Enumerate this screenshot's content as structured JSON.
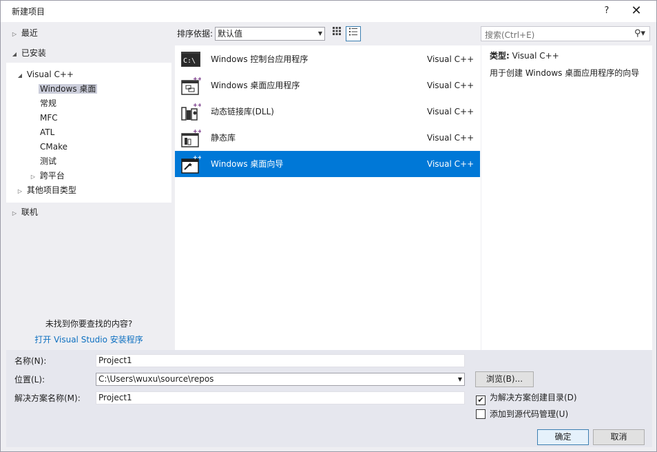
{
  "window": {
    "title": "新建项目",
    "help": "?",
    "close": "✕"
  },
  "tree": {
    "recent": "最近",
    "installed": "已安装",
    "visual_cpp": "Visual C++",
    "leaves": [
      "Windows 桌面",
      "常规",
      "MFC",
      "ATL",
      "CMake",
      "测试"
    ],
    "cross_platform": "跨平台",
    "other_types": "其他项目类型",
    "online": "联机",
    "not_found": "未找到你要查找的内容?",
    "installer_link": "打开 Visual Studio 安装程序"
  },
  "sort": {
    "label": "排序依据:",
    "value": "默认值"
  },
  "search": {
    "placeholder": "搜索(Ctrl+E)"
  },
  "templates": [
    {
      "name": "Windows 控制台应用程序",
      "lang": "Visual C++",
      "icon": "console-app-icon"
    },
    {
      "name": "Windows 桌面应用程序",
      "lang": "Visual C++",
      "icon": "desktop-app-icon"
    },
    {
      "name": "动态链接库(DLL)",
      "lang": "Visual C++",
      "icon": "dll-icon"
    },
    {
      "name": "静态库",
      "lang": "Visual C++",
      "icon": "static-lib-icon"
    },
    {
      "name": "Windows 桌面向导",
      "lang": "Visual C++",
      "icon": "desktop-wizard-icon"
    }
  ],
  "selected_template": "Windows 桌面向导",
  "description": {
    "type_label": "类型:",
    "type_value": "Visual C++",
    "text": "用于创建 Windows 桌面应用程序的向导"
  },
  "form": {
    "name_label": "名称(N):",
    "name_value": "Project1",
    "location_label": "位置(L):",
    "location_value": "C:\\Users\\wuxu\\source\\repos",
    "solution_label": "解决方案名称(M):",
    "solution_value": "Project1",
    "browse": "浏览(B)...",
    "create_dir_label": "为解决方案创建目录(D)",
    "create_dir_checked": true,
    "source_control_label": "添加到源代码管理(U)",
    "source_control_checked": false,
    "ok": "确定",
    "cancel": "取消"
  },
  "colors": {
    "selection": "#0078d7",
    "link": "#0e70c0",
    "tree_selection": "#cccedb"
  }
}
